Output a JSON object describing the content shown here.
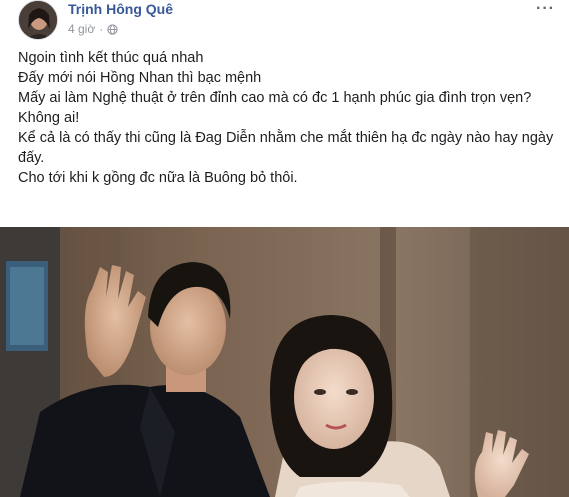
{
  "post": {
    "author": "Trịnh Hông Quê",
    "time": "4 giờ",
    "separator": "·",
    "privacy_icon": "globe-icon",
    "more_icon": "more-options-icon",
    "lines": [
      "Ngoin tình kết thúc quá nhah",
      "Đấy mới nói Hồng Nhan thì bạc mệnh",
      "Mấy ai làm Nghệ thuật ở trên đỉnh cao mà có đc 1 hạnh phúc gia đình trọn vẹn?",
      "Không ai!",
      "Kể cả là có thấy thi cũng là Đag Diễn nhằm che mắt thiên hạ đc ngày nào hay ngày đấy.",
      "Cho tới khi k gồng đc nữa là Buông bỏ thôi."
    ]
  },
  "colors": {
    "author_link": "#385898",
    "meta_text": "#90949c",
    "body_text": "#1c1e21"
  }
}
